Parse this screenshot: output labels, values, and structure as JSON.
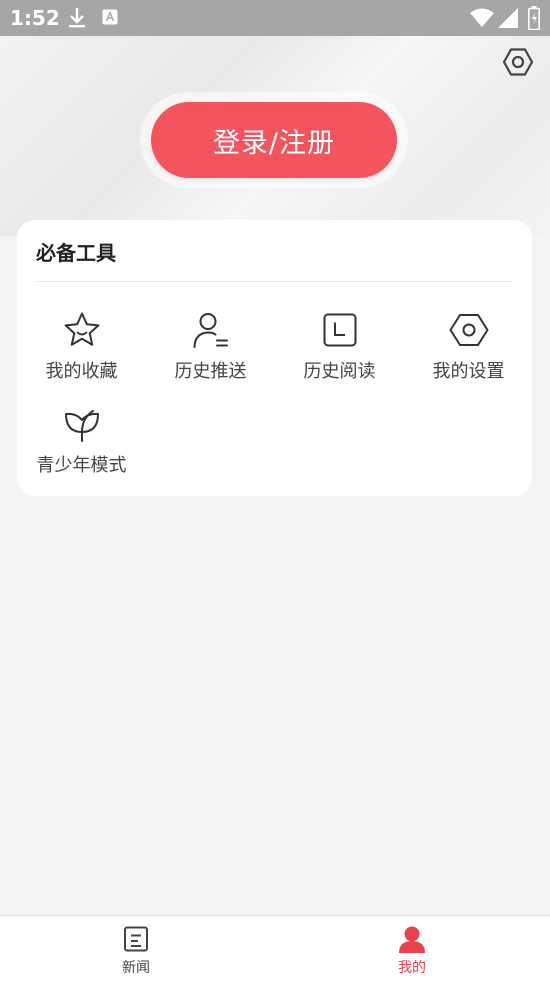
{
  "status_bar": {
    "time": "1:52"
  },
  "header": {
    "login_label": "登录/注册"
  },
  "tools": {
    "title": "必备工具",
    "items": [
      {
        "label": "我的收藏",
        "icon": "star-icon"
      },
      {
        "label": "历史推送",
        "icon": "user-list-icon"
      },
      {
        "label": "历史阅读",
        "icon": "history-square-icon"
      },
      {
        "label": "我的设置",
        "icon": "settings-hexagon-icon"
      },
      {
        "label": "青少年模式",
        "icon": "leaf-icon"
      }
    ]
  },
  "bottom_nav": {
    "items": [
      {
        "label": "新闻",
        "icon": "news-icon",
        "active": false
      },
      {
        "label": "我的",
        "icon": "profile-icon",
        "active": true
      }
    ]
  },
  "colors": {
    "accent": "#f2555e",
    "status_bar": "#a6a6a6",
    "active_nav": "#e8434d"
  }
}
